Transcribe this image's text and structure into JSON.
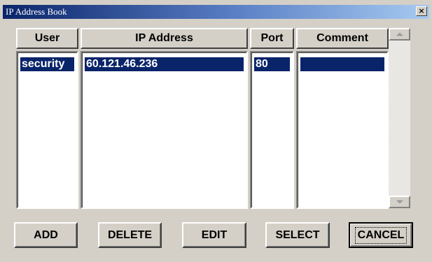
{
  "window": {
    "title": "IP Address Book",
    "close_label": "×"
  },
  "columns": {
    "user": "User",
    "ip_address": "IP Address",
    "port": "Port",
    "comment": "Comment"
  },
  "rows": [
    {
      "user": "security",
      "ip_address": "60.121.46.236",
      "port": "80",
      "comment": ""
    }
  ],
  "buttons": {
    "add": "ADD",
    "delete": "DELETE",
    "edit": "EDIT",
    "select": "SELECT",
    "cancel": "CANCEL"
  },
  "colors": {
    "title_start": "#0a246a",
    "title_end": "#a6caf0",
    "selection": "#0a246a",
    "face": "#d4d0c8"
  },
  "icons": {
    "close": "close-icon",
    "scroll_up": "scroll-up-arrow-icon",
    "scroll_down": "scroll-down-arrow-icon"
  }
}
